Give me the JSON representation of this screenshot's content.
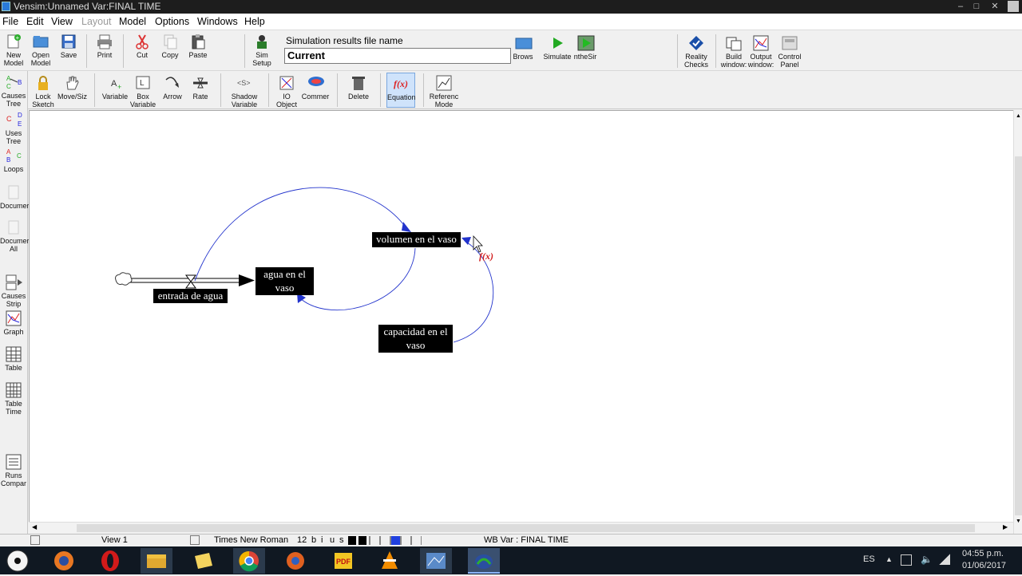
{
  "window": {
    "title": "Vensim:Unnamed Var:FINAL TIME"
  },
  "menu": {
    "file": "File",
    "edit": "Edit",
    "view": "View",
    "layout": "Layout",
    "model": "Model",
    "options": "Options",
    "windows": "Windows",
    "help": "Help"
  },
  "toolbar1": {
    "new_model": [
      "New",
      "Model"
    ],
    "open_model": [
      "Open",
      "Model"
    ],
    "save": "Save",
    "print": "Print",
    "cut": "Cut",
    "copy": "Copy",
    "paste": "Paste",
    "sim_setup": [
      "Sim",
      "Setup"
    ],
    "sim_results_label": "Simulation results file name",
    "sim_results_value": "Current",
    "browse": "Brows",
    "simulate": "Simulate",
    "synthesim": "ntheSir",
    "reality_checks": [
      "Reality",
      "Checks"
    ],
    "build_windows": [
      "Build",
      "window:"
    ],
    "output_windows": [
      "Output",
      "window:"
    ],
    "control_panel": [
      "Control",
      "Panel"
    ]
  },
  "toolbar2": {
    "lock_sketch": [
      "Lock",
      "Sketch"
    ],
    "move_size": "Move/Siz",
    "variable": "Variable",
    "box_variable": [
      "Box",
      "Variable"
    ],
    "arrow": "Arrow",
    "rate": "Rate",
    "shadow_variable": [
      "Shadow",
      "Variable"
    ],
    "io_object": [
      "IO",
      "Object"
    ],
    "comment": "Commer",
    "delete": "Delete",
    "equation": "Equation",
    "reference_mode": [
      "Referenc",
      "Mode"
    ]
  },
  "leftbar": {
    "causes_tree": [
      "Causes",
      "Tree"
    ],
    "uses_tree": [
      "Uses",
      "Tree"
    ],
    "loops": "Loops",
    "document": "Documer",
    "document_all": [
      "Documer",
      "All"
    ],
    "causes_strip": [
      "Causes",
      "Strip"
    ],
    "graph": "Graph",
    "table": "Table",
    "table_time": [
      "Table",
      "Time"
    ],
    "runs_compare": [
      "Runs",
      "Compar"
    ]
  },
  "model": {
    "stock": [
      "agua en el",
      "vaso"
    ],
    "rate": "entrada de agua",
    "aux1": "volumen en el vaso",
    "aux2": [
      "capacidad en el",
      "vaso"
    ],
    "fx": "f(x)"
  },
  "statusbar": {
    "view": "View 1",
    "font": "Times New Roman",
    "size": "12",
    "bold": "b",
    "italic": "i",
    "underline": "u",
    "strike": "s",
    "workbench": "WB Var : FINAL TIME"
  },
  "taskbar": {
    "lang": "ES",
    "time": "04:55 p.m.",
    "date": "01/06/2017"
  },
  "colors": {
    "arrow": "#2233cc",
    "fx": "#d22222",
    "taskbar": "#101822"
  }
}
